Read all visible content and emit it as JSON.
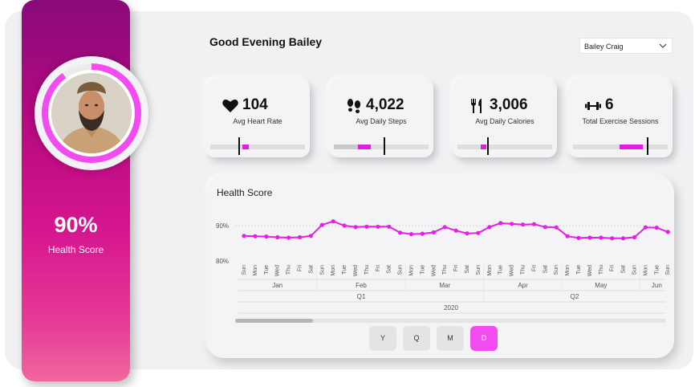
{
  "sidebar": {
    "health_score_value": "90%",
    "health_score_label": "Health Score",
    "health_score_fraction": 0.9,
    "ring_color": "#f24cf0"
  },
  "header": {
    "greeting": "Good Evening Bailey",
    "user_select": {
      "selected": "Bailey Craig"
    }
  },
  "kpis": [
    {
      "icon": "heart-icon",
      "value": "104",
      "label": "Avg Heart Rate",
      "progress": 0.06,
      "target": 0.3
    },
    {
      "icon": "footsteps-icon",
      "value": "4,022",
      "label": "Avg Daily Steps",
      "progress": 0.13,
      "target": 0.51
    },
    {
      "icon": "fork-knife-icon",
      "value": "3,006",
      "label": "Avg Daily Calories",
      "progress": 0.06,
      "target": 0.32
    },
    {
      "icon": "dumbbell-icon",
      "value": "6",
      "label": "Total Exercise Sessions",
      "progress": 0.25,
      "target": 0.78
    }
  ],
  "chart": {
    "title": "Health Score",
    "controls": [
      {
        "label": "Y",
        "active": false
      },
      {
        "label": "Q",
        "active": false
      },
      {
        "label": "M",
        "active": false
      },
      {
        "label": "D",
        "active": true
      }
    ]
  },
  "chart_data": {
    "type": "line",
    "title": "Health Score",
    "ylabels": [
      "90%",
      "80%"
    ],
    "ylim": [
      80,
      93
    ],
    "x": [
      "Sun",
      "Mon",
      "Tue",
      "Wed",
      "Thu",
      "Fri",
      "Sat",
      "Sun",
      "Mon",
      "Tue",
      "Wed",
      "Thu",
      "Fri",
      "Sat",
      "Sun",
      "Mon",
      "Tue",
      "Wed",
      "Thu",
      "Fri",
      "Sat",
      "Sun",
      "Mon",
      "Tue",
      "Wed",
      "Thu",
      "Fri",
      "Sat",
      "Sun",
      "Mon",
      "Tue",
      "Wed",
      "Thu",
      "Fri",
      "Sat",
      "Sun",
      "Mon",
      "Tue"
    ],
    "values": [
      87.1,
      87.0,
      86.9,
      86.7,
      86.6,
      86.7,
      87.1,
      90.2,
      91.2,
      90.0,
      89.6,
      89.7,
      89.7,
      89.7,
      88.0,
      87.6,
      87.7,
      88.1,
      89.6,
      88.6,
      87.8,
      87.9,
      89.6,
      90.7,
      90.5,
      90.3,
      90.4,
      89.6,
      89.5,
      87.0,
      86.5,
      86.6,
      86.6,
      86.4,
      86.4,
      86.7,
      89.5,
      89.4,
      88.2
    ],
    "months": [
      "Jan",
      "Feb",
      "Mar",
      "Apr",
      "May",
      "Jun"
    ],
    "quarters": [
      "Q1",
      "Q2"
    ],
    "year": "2020",
    "series_color": "#e81ee8",
    "grid": true
  }
}
